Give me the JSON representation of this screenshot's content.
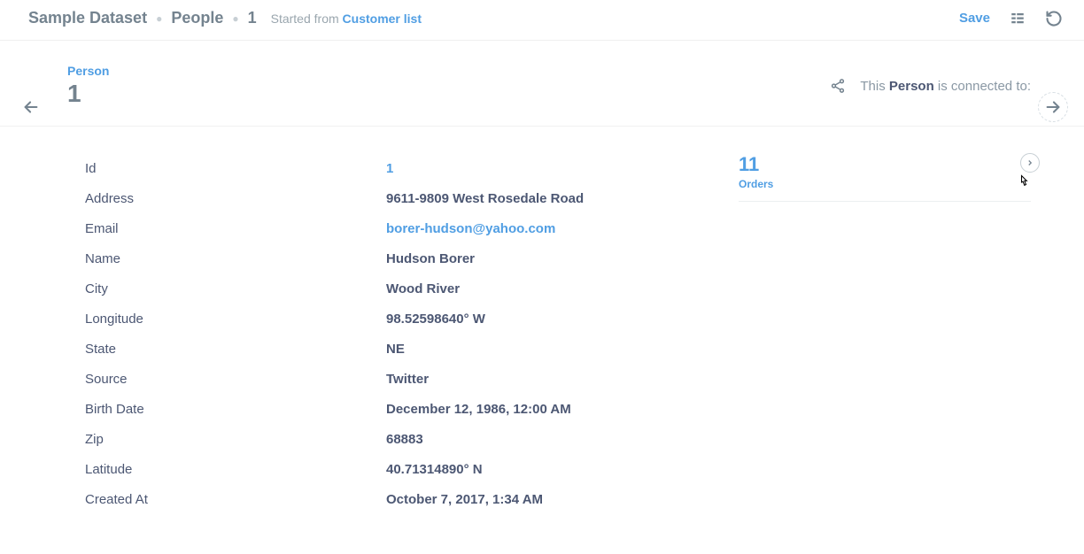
{
  "topbar": {
    "crumb1": "Sample Dataset",
    "crumb2": "People",
    "crumb3": "1",
    "started_prefix": "Started from ",
    "started_link": "Customer list",
    "save_label": "Save"
  },
  "entity": {
    "label": "Person",
    "id": "1"
  },
  "connections_text": {
    "prefix": "This ",
    "bold": "Person",
    "suffix": " is connected to:"
  },
  "related": {
    "count": "11",
    "label": "Orders"
  },
  "fields": [
    {
      "label": "Id",
      "value": "1",
      "link": true
    },
    {
      "label": "Address",
      "value": "9611-9809 West Rosedale Road",
      "link": false
    },
    {
      "label": "Email",
      "value": "borer-hudson@yahoo.com",
      "link": true
    },
    {
      "label": "Name",
      "value": "Hudson Borer",
      "link": false
    },
    {
      "label": "City",
      "value": "Wood River",
      "link": false
    },
    {
      "label": "Longitude",
      "value": "98.52598640° W",
      "link": false
    },
    {
      "label": "State",
      "value": "NE",
      "link": false
    },
    {
      "label": "Source",
      "value": "Twitter",
      "link": false
    },
    {
      "label": "Birth Date",
      "value": "December 12, 1986, 12:00 AM",
      "link": false
    },
    {
      "label": "Zip",
      "value": "68883",
      "link": false
    },
    {
      "label": "Latitude",
      "value": "40.71314890° N",
      "link": false
    },
    {
      "label": "Created At",
      "value": "October 7, 2017, 1:34 AM",
      "link": false
    }
  ]
}
